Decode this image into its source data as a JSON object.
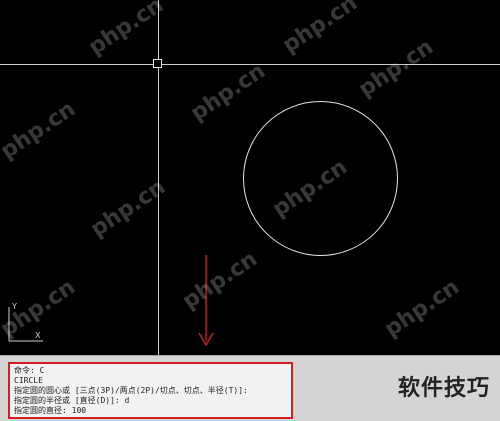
{
  "canvas": {
    "background": "#000000",
    "crosshair_color": "#cfcfcf",
    "entity_color": "#e6e6e6",
    "entities": [
      {
        "type": "circle",
        "name": "drawn-circle"
      }
    ]
  },
  "ucs_icon": {
    "x_label": "X",
    "y_label": "Y"
  },
  "annotation": {
    "arrow_color": "#d21f1f"
  },
  "command_window": {
    "highlight_color": "#d21f1f",
    "lines": [
      "命令: C",
      "CIRCLE",
      "指定圆的圆心或 [三点(3P)/两点(2P)/切点、切点、半径(T)]:",
      "指定圆的半径或 [直径(D)]: d",
      "指定圆的直径: 100"
    ]
  },
  "watermarks": [
    "php.cn",
    "php.cn",
    "php.cn",
    "php.cn",
    "php.cn",
    "php.cn",
    "php.cn",
    "php.cn",
    "php.cn",
    "php.cn"
  ],
  "brand": {
    "text": "软件技巧"
  }
}
